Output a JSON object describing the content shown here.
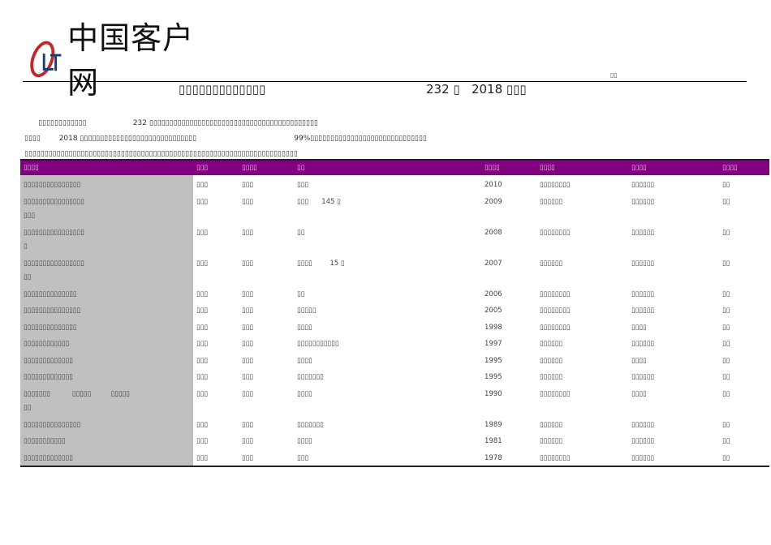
{
  "logo": {
    "mark": "CLT",
    "text": "中国客户网"
  },
  "header_small": "▯▯",
  "title": {
    "left": "▯▯▯▯▯▯▯▯▯▯▯▯▯",
    "right": "232 ▯   2018 ▯▯▯"
  },
  "paragraph": [
    "      ▯▯▯▯▯▯▯▯▯▯▯▯                    232 ▯▯▯▯▯▯▯▯▯▯▯▯▯▯▯▯▯▯▯▯▯▯▯▯▯▯▯▯▯▯▯▯▯▯▯▯▯▯▯▯▯▯",
    "▯▯▯▯        2018 ▯▯▯▯▯▯▯▯▯▯▯▯▯▯▯▯▯▯▯▯▯▯▯▯▯▯▯▯▯                                          99%▯▯▯▯▯▯▯▯▯▯▯▯▯▯▯▯▯▯▯▯▯▯▯▯▯▯▯▯▯",
    "▯▯▯▯▯▯▯▯▯▯▯▯▯▯▯▯▯▯▯▯▯▯▯▯▯▯▯▯▯▯▯▯▯▯▯▯▯▯▯▯▯▯▯▯▯▯▯▯▯▯▯▯▯▯▯▯▯▯▯▯▯▯▯▯▯▯▯▯"
  ],
  "table": {
    "headers": [
      "▯▯▯▯",
      "▯▯▯",
      "▯▯▯▯",
      "▯▯",
      "▯▯▯▯",
      "▯▯▯▯",
      "▯▯▯▯",
      "▯▯▯▯"
    ],
    "rows": [
      [
        "▯▯▯▯▯▯▯▯▯▯▯▯▯▯▯",
        "▯▯▯",
        "▯▯▯",
        "▯▯▯",
        "2010",
        "▯▯▯▯▯▯▯▯",
        "▯▯▯▯▯▯",
        "▯▯"
      ],
      [
        "▯▯▯▯▯▯▯▯▯▯▯▯▯▯▯▯\n▯▯▯",
        "▯▯▯",
        "▯▯▯",
        "▯▯▯      145 ▯",
        "2009",
        "▯▯▯▯▯▯",
        "▯▯▯▯▯▯",
        "▯▯"
      ],
      [
        "▯▯▯▯▯▯▯▯▯▯▯▯▯▯▯▯\n▯",
        "▯▯▯",
        "▯▯▯",
        "▯▯",
        "2008",
        "▯▯▯▯▯▯▯▯",
        "▯▯▯▯▯▯",
        "▯▯"
      ],
      [
        "▯▯▯▯▯▯▯▯▯▯▯▯▯▯▯▯\n▯▯",
        "▯▯▯",
        "▯▯▯",
        "▯▯▯▯        15 ▯",
        "2007",
        "▯▯▯▯▯▯",
        "▯▯▯▯▯▯",
        "▯▯"
      ],
      [
        "▯▯▯▯▯▯▯▯▯▯▯▯▯▯",
        "▯▯▯",
        "▯▯▯",
        "▯▯",
        "2006",
        "▯▯▯▯▯▯▯▯",
        "▯▯▯▯▯▯",
        "▯▯"
      ],
      [
        "▯▯▯▯▯▯▯▯▯▯▯▯▯▯▯",
        "▯▯▯",
        "▯▯▯",
        "▯▯▯▯▯",
        "2005",
        "▯▯▯▯▯▯▯▯",
        "▯▯▯▯▯▯",
        "▯▯"
      ],
      [
        "▯▯▯▯▯▯▯▯▯▯▯▯▯▯",
        "▯▯▯",
        "▯▯▯",
        "▯▯▯▯",
        "1998",
        "▯▯▯▯▯▯▯▯",
        "▯▯▯▯",
        "▯▯"
      ],
      [
        "▯▯▯▯▯▯▯▯▯▯▯▯",
        "▯▯▯",
        "▯▯▯",
        "▯▯▯▯▯▯▯▯▯▯▯",
        "1997",
        "▯▯▯▯▯▯",
        "▯▯▯▯▯▯",
        "▯▯"
      ],
      [
        "▯▯▯▯▯▯▯▯▯▯▯▯▯",
        "▯▯▯",
        "▯▯▯",
        "▯▯▯▯",
        "1995",
        "▯▯▯▯▯▯",
        "▯▯▯▯",
        "▯▯"
      ],
      [
        "▯▯▯▯▯▯▯▯▯▯▯▯▯",
        "▯▯▯",
        "▯▯▯",
        "▯▯▯▯▯▯▯",
        "1995",
        "▯▯▯▯▯▯",
        "▯▯▯▯▯▯",
        "▯▯"
      ],
      [
        "▯▯▯▯▯▯▯          ▯▯▯▯▯         ▯▯▯▯▯\n▯▯",
        "▯▯▯",
        "▯▯▯",
        "▯▯▯▯",
        "1990",
        "▯▯▯▯▯▯▯▯",
        "▯▯▯▯",
        "▯▯"
      ],
      [
        "▯▯▯▯▯▯▯▯▯▯▯▯▯▯▯",
        "▯▯▯",
        "▯▯▯",
        "▯▯▯▯▯▯▯",
        "1989",
        "▯▯▯▯▯▯",
        "▯▯▯▯▯▯",
        "▯▯"
      ],
      [
        "▯▯▯▯▯▯▯▯▯▯▯",
        "▯▯▯",
        "▯▯▯",
        "▯▯▯▯",
        "1981",
        "▯▯▯▯▯▯",
        "▯▯▯▯▯▯",
        "▯▯"
      ],
      [
        "▯▯▯▯▯▯▯▯▯▯▯▯▯",
        "▯▯▯",
        "▯▯▯",
        "▯▯▯",
        "1978",
        "▯▯▯▯▯▯▯▯",
        "▯▯▯▯▯▯",
        "▯▯"
      ]
    ]
  },
  "colors": {
    "header_bg": "#800080",
    "first_col_bg": "#c0c0c0"
  }
}
